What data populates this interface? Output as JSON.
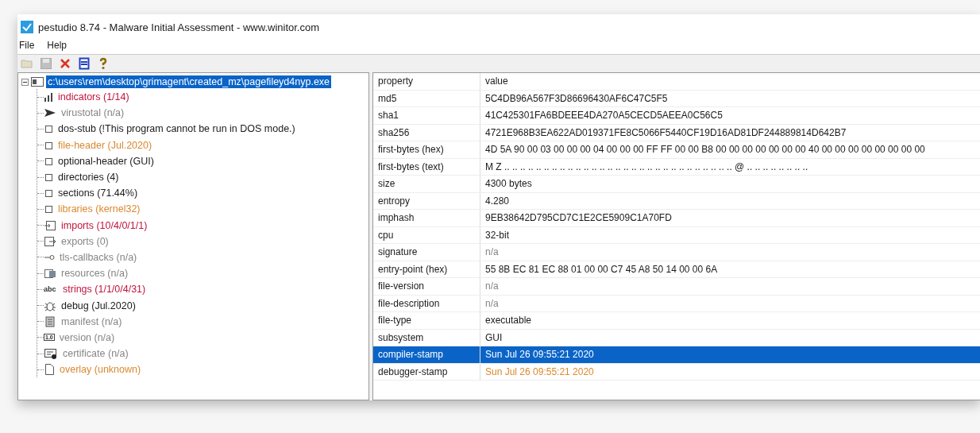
{
  "window": {
    "title": "pestudio 8.74 - Malware Initial Assessment - www.winitor.com"
  },
  "menu": [
    {
      "label": "File"
    },
    {
      "label": "Help"
    }
  ],
  "toolbar": [
    {
      "kind": "open",
      "disabled": true
    },
    {
      "kind": "save",
      "disabled": true
    },
    {
      "kind": "close",
      "disabled": false
    },
    {
      "kind": "list",
      "disabled": false
    },
    {
      "kind": "help",
      "disabled": false
    }
  ],
  "tree": {
    "label": "c:\\users\\rem\\desktop\\grimagent\\created_mz\\pagefileyd4nyp.exe",
    "selected": true,
    "expanded": true,
    "children": [
      {
        "kind": "bars",
        "label": "indicators (1/14)",
        "color": "#c0143c"
      },
      {
        "kind": "virustotal",
        "label": "virustotal (n/a)",
        "color": "#858585"
      },
      {
        "kind": "square",
        "label": "dos-stub (!This program cannot be run in DOS mode.)",
        "color": "#1a1a1a"
      },
      {
        "kind": "square",
        "label": "file-header (Jul.2020)",
        "color": "#d9892f"
      },
      {
        "kind": "square",
        "label": "optional-header (GUI)",
        "color": "#1a1a1a"
      },
      {
        "kind": "square",
        "label": "directories (4)",
        "color": "#1a1a1a"
      },
      {
        "kind": "square",
        "label": "sections (71.44%)",
        "color": "#1a1a1a"
      },
      {
        "kind": "square",
        "label": "libraries (kernel32)",
        "color": "#d9892f"
      },
      {
        "kind": "imports",
        "label": "imports (10/4/0/1/1)",
        "color": "#c0143c"
      },
      {
        "kind": "exports",
        "label": "exports (0)",
        "color": "#858585"
      },
      {
        "kind": "tls",
        "label": "tls-callbacks (n/a)",
        "color": "#858585"
      },
      {
        "kind": "resources",
        "label": "resources (n/a)",
        "color": "#858585"
      },
      {
        "kind": "strings",
        "label": "strings (1/1/0/4/31)",
        "color": "#c0143c",
        "icon_text": "abc"
      },
      {
        "kind": "debug",
        "label": "debug (Jul.2020)",
        "color": "#1a1a1a"
      },
      {
        "kind": "manifest",
        "label": "manifest (n/a)",
        "color": "#858585"
      },
      {
        "kind": "version",
        "label": "version (n/a)",
        "color": "#858585",
        "icon_text": "1.0"
      },
      {
        "kind": "certificate",
        "label": "certificate (n/a)",
        "color": "#858585"
      },
      {
        "kind": "document",
        "label": "overlay (unknown)",
        "color": "#d9892f"
      }
    ]
  },
  "table": {
    "columns": [
      "property",
      "value"
    ],
    "rows": [
      {
        "property": "md5",
        "value": "5C4DB96A567F3D86696430AF6C47C5F5",
        "selected": false,
        "color": "#1a1a1a"
      },
      {
        "property": "sha1",
        "value": "41C425301FA6BDEEE4DA270A5CECD5AEEA0C56C5",
        "selected": false,
        "color": "#1a1a1a"
      },
      {
        "property": "sha256",
        "value": "4721E968B3EA622AD019371FE8C5066F5440CF19D16AD81DF244889814D642B7",
        "selected": false,
        "color": "#1a1a1a"
      },
      {
        "property": "first-bytes (hex)",
        "value": "4D 5A 90 00 03 00 00 00 04 00 00 00 FF FF 00 00 B8 00 00 00 00 00 00 00 40 00 00 00 00 00 00 00 00",
        "selected": false,
        "color": "#1a1a1a"
      },
      {
        "property": "first-bytes (text)",
        "value": "M Z .. .. .. .. .. .. .. .. .. .. .. .. .. .. .. .. .. .. .. .. .. .. .. .. .. .. .. .. .. @ .. .. .. .. .. .. .. ..",
        "selected": false,
        "color": "#1a1a1a"
      },
      {
        "property": "size",
        "value": "4300 bytes",
        "selected": false,
        "color": "#1a1a1a"
      },
      {
        "property": "entropy",
        "value": "4.280",
        "selected": false,
        "color": "#1a1a1a"
      },
      {
        "property": "imphash",
        "value": "9EB38642D795CD7C1E2CE5909C1A70FD",
        "selected": false,
        "color": "#1a1a1a"
      },
      {
        "property": "cpu",
        "value": "32-bit",
        "selected": false,
        "color": "#1a1a1a"
      },
      {
        "property": "signature",
        "value": "n/a",
        "selected": false,
        "color": "#858585"
      },
      {
        "property": "entry-point (hex)",
        "value": "55 8B EC 81 EC 88 01 00 00 C7 45 A8 50 14 00 00 6A",
        "selected": false,
        "color": "#1a1a1a"
      },
      {
        "property": "file-version",
        "value": "n/a",
        "selected": false,
        "color": "#858585"
      },
      {
        "property": "file-description",
        "value": "n/a",
        "selected": false,
        "color": "#858585"
      },
      {
        "property": "file-type",
        "value": "executable",
        "selected": false,
        "color": "#1a1a1a"
      },
      {
        "property": "subsystem",
        "value": "GUI",
        "selected": false,
        "color": "#1a1a1a"
      },
      {
        "property": "compiler-stamp",
        "value": "Sun Jul 26 09:55:21 2020",
        "selected": true
      },
      {
        "property": "debugger-stamp",
        "value": "Sun Jul 26 09:55:21 2020",
        "selected": false,
        "color": "#d9892f"
      }
    ]
  }
}
